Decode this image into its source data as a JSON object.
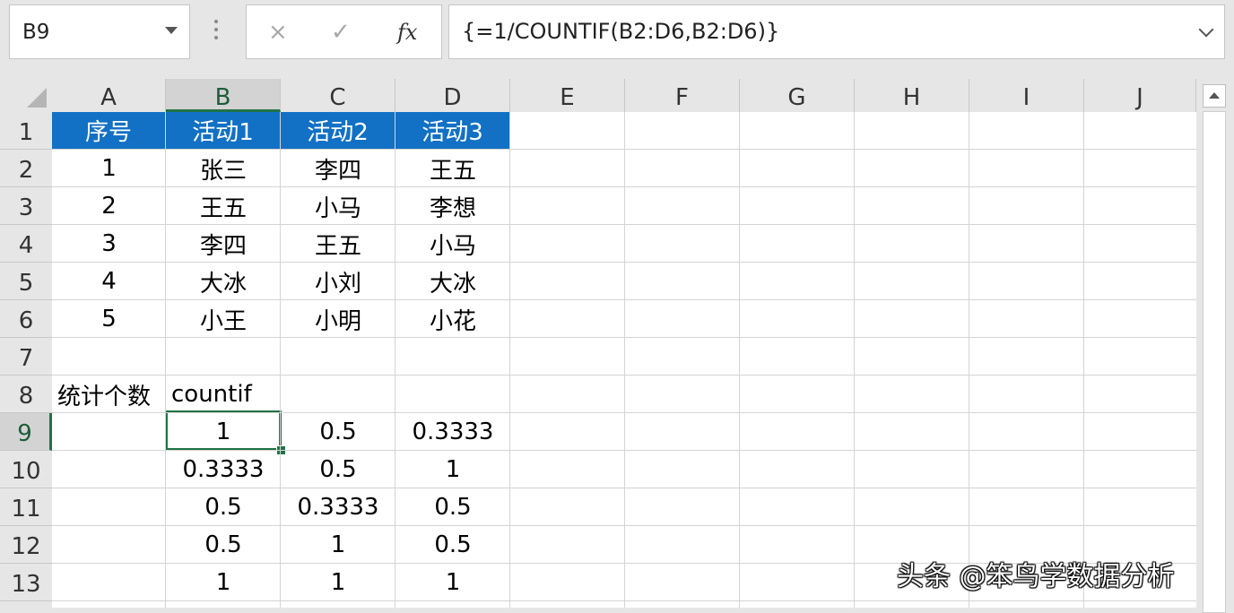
{
  "name_box": {
    "value": "B9"
  },
  "formula_bar": {
    "cancel_icon": "×",
    "enter_icon": "✓",
    "fx_label": "fx",
    "formula": "{=1/COUNTIF(B2:D6,B2:D6)}"
  },
  "columns": [
    "A",
    "B",
    "C",
    "D",
    "E",
    "F",
    "G",
    "H",
    "I",
    "J"
  ],
  "rows": [
    "1",
    "2",
    "3",
    "4",
    "5",
    "6",
    "7",
    "8",
    "9",
    "10",
    "11",
    "12",
    "13"
  ],
  "selected": {
    "column": "B",
    "row": "9"
  },
  "colors": {
    "header_fill": "#1271C4",
    "selection": "#217346"
  },
  "cells": {
    "A1": "序号",
    "B1": "活动1",
    "C1": "活动2",
    "D1": "活动3",
    "A2": "1",
    "B2": "张三",
    "C2": "李四",
    "D2": "王五",
    "A3": "2",
    "B3": "王五",
    "C3": "小马",
    "D3": "李想",
    "A4": "3",
    "B4": "李四",
    "C4": "王五",
    "D4": "小马",
    "A5": "4",
    "B5": "大冰",
    "C5": "小刘",
    "D5": "大冰",
    "A6": "5",
    "B6": "小王",
    "C6": "小明",
    "D6": "小花",
    "A8": "统计个数",
    "B8": "countif",
    "B9": "1",
    "C9": "0.5",
    "D9": "0.3333",
    "B10": "0.3333",
    "C10": "0.5",
    "D10": "1",
    "B11": "0.5",
    "C11": "0.3333",
    "D11": "0.5",
    "B12": "0.5",
    "C12": "1",
    "D12": "0.5",
    "B13": "1",
    "C13": "1",
    "D13": "1"
  },
  "watermark": "头条 @笨鸟学数据分析"
}
